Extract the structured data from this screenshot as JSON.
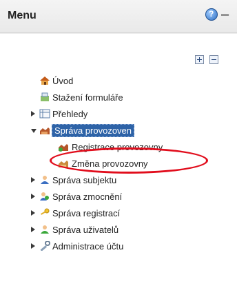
{
  "header": {
    "title": "Menu",
    "help_icon": "help-icon",
    "minimize_icon": "minimize-icon"
  },
  "tree": {
    "expand_all_icon": "plus-box-icon",
    "collapse_all_icon": "minus-box-icon",
    "items": [
      {
        "label": "Úvod",
        "icon": "home-icon"
      },
      {
        "label": "Stažení formuláře",
        "icon": "download-form-icon"
      },
      {
        "label": "Přehledy",
        "icon": "table-icon"
      },
      {
        "label": "Správa provozoven",
        "icon": "warehouse-icon",
        "children": [
          {
            "label": "Registrace provozovny",
            "icon": "factory-add-icon"
          },
          {
            "label": "Změna provozovny",
            "icon": "factory-edit-icon"
          }
        ]
      },
      {
        "label": "Správa subjektu",
        "icon": "user-icon"
      },
      {
        "label": "Správa zmocnění",
        "icon": "users-icon"
      },
      {
        "label": "Správa registrací",
        "icon": "key-icon"
      },
      {
        "label": "Správa uživatelů",
        "icon": "user-group-icon"
      },
      {
        "label": "Administrace účtu",
        "icon": "wrench-icon"
      }
    ]
  },
  "annotation": {
    "highlight_color": "#e10d1c"
  }
}
